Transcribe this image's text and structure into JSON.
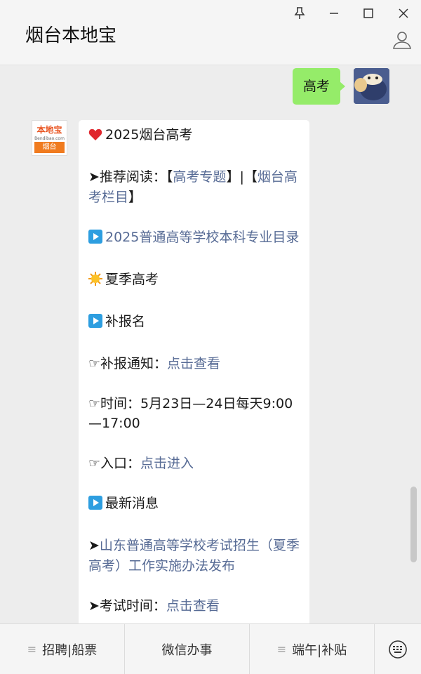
{
  "window": {
    "title": "烟台本地宝",
    "icons": [
      "pin-icon",
      "minimize-icon",
      "maximize-icon",
      "close-icon",
      "profile-icon"
    ]
  },
  "my_message": {
    "text": "高考"
  },
  "bot_avatar": {
    "logo_text": "本地宝",
    "logo_url": "Bendibao.com",
    "city": "烟台"
  },
  "message": {
    "l1": "2025烟台高考",
    "l2_prefix": "➤推荐阅读：【",
    "l2_link1": "高考专题",
    "l2_mid": "】|【",
    "l2_link2": "烟台高考栏目",
    "l2_suffix": "】",
    "l3_link": "2025普通高等学校本科专业目录",
    "l4": "夏季高考",
    "l5": "补报名",
    "l6_prefix": "☞补报通知：",
    "l6_link": "点击查看",
    "l7_prefix": "☞时间：",
    "l7_text": "5月23日—24日每天9:00—17:00",
    "l8_prefix": "☞入口：",
    "l8_link": "点击进入",
    "l9": "最新消息",
    "l10_prefix": "➤",
    "l10_link": "山东普通高等学校考试招生（夏季高考）工作实施办法发布",
    "l11_prefix": "➤考试时间：",
    "l11_link": "点击查看"
  },
  "bottom_menu": {
    "item1": "招聘|船票",
    "item2": "微信办事",
    "item3": "端午|补贴"
  },
  "colors": {
    "bubble_green": "#95ec69",
    "link": "#576b95",
    "background": "#ededed"
  }
}
